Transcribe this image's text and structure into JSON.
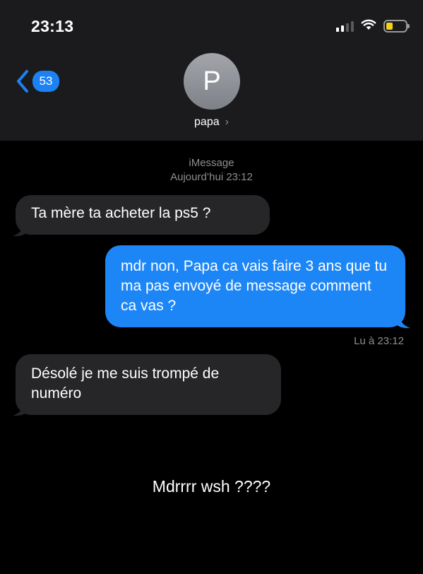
{
  "status_bar": {
    "time": "23:13"
  },
  "header": {
    "back_count": "53",
    "avatar_initial": "P",
    "contact_name": "papa",
    "contact_chevron": "›"
  },
  "conversation": {
    "service_label": "iMessage",
    "date_label": "Aujourd’hui 23:12",
    "messages": [
      {
        "direction": "received",
        "text": "Ta mère ta acheter la ps5 ?"
      },
      {
        "direction": "sent",
        "text": "mdr non, Papa ca vais faire 3 ans que tu ma pas envoyé de message comment ca vas ?"
      },
      {
        "direction": "received",
        "text": "Désolé je me suis trompé de numéro"
      }
    ],
    "read_receipt": "Lu à 23:12"
  },
  "caption": "Mdrrrr wsh ????",
  "colors": {
    "sent_bubble": "#1d86f7",
    "received_bubble": "#262629",
    "header_background": "#1b1b1d",
    "accent_blue": "#1c82f4",
    "battery_low": "#f3d21d"
  },
  "icons": [
    "back-chevron-icon",
    "signal-icon",
    "wifi-icon",
    "battery-icon",
    "chevron-right-icon"
  ]
}
